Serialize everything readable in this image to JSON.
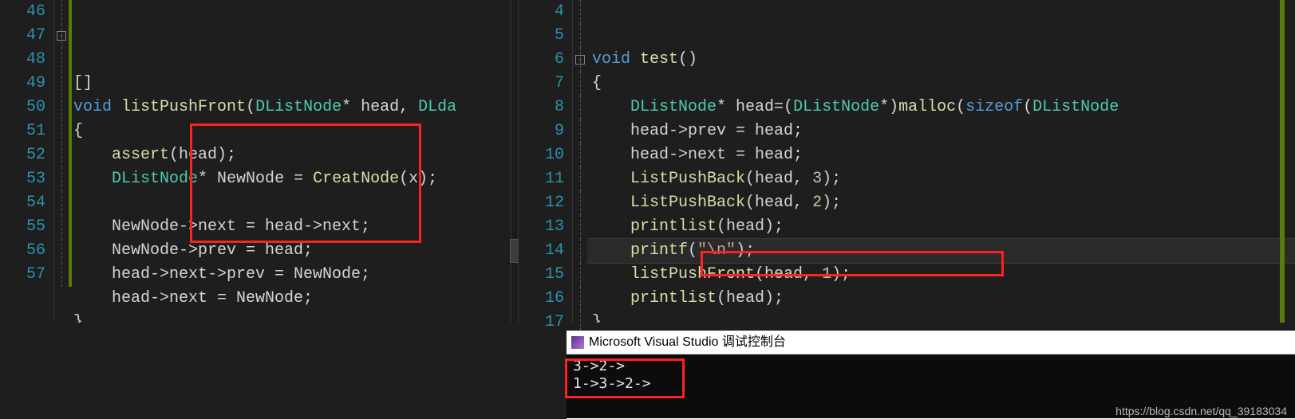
{
  "left": {
    "lineStart": 46,
    "lines": [
      {
        "raw": "[]"
      },
      {
        "raw": "void listPushFront(DListNode* head, DLda",
        "fold": "box"
      },
      {
        "raw": "{"
      },
      {
        "raw": "    assert(head);"
      },
      {
        "raw": "    DListNode* NewNode = CreatNode(x);"
      },
      {
        "raw": ""
      },
      {
        "raw": "    NewNode->next = head->next;"
      },
      {
        "raw": "    NewNode->prev = head;"
      },
      {
        "raw": "    head->next->prev = NewNode;"
      },
      {
        "raw": "    head->next = NewNode;"
      },
      {
        "raw": "}"
      },
      {
        "raw": "}"
      }
    ]
  },
  "right": {
    "lineStart": 4,
    "lines": [
      {
        "raw": ""
      },
      {
        "raw": ""
      },
      {
        "raw": "void test()",
        "fold": "box"
      },
      {
        "raw": "{"
      },
      {
        "raw": "    DListNode* head=(DListNode*)malloc(sizeof(DListNode"
      },
      {
        "raw": "    head->prev = head;"
      },
      {
        "raw": "    head->next = head;"
      },
      {
        "raw": "    ListPushBack(head, 3);"
      },
      {
        "raw": "    ListPushBack(head, 2);"
      },
      {
        "raw": "    printlist(head);"
      },
      {
        "raw": "    printf(\"\\n\");",
        "hl": true
      },
      {
        "raw": "    listPushFront(head, 1);"
      },
      {
        "raw": "    printlist(head);"
      },
      {
        "raw": "}"
      }
    ]
  },
  "console": {
    "title": "Microsoft Visual Studio 调试控制台",
    "lines": [
      "3->2->",
      "1->3->2->"
    ]
  },
  "watermark": "https://blog.csdn.net/qq_39183034"
}
